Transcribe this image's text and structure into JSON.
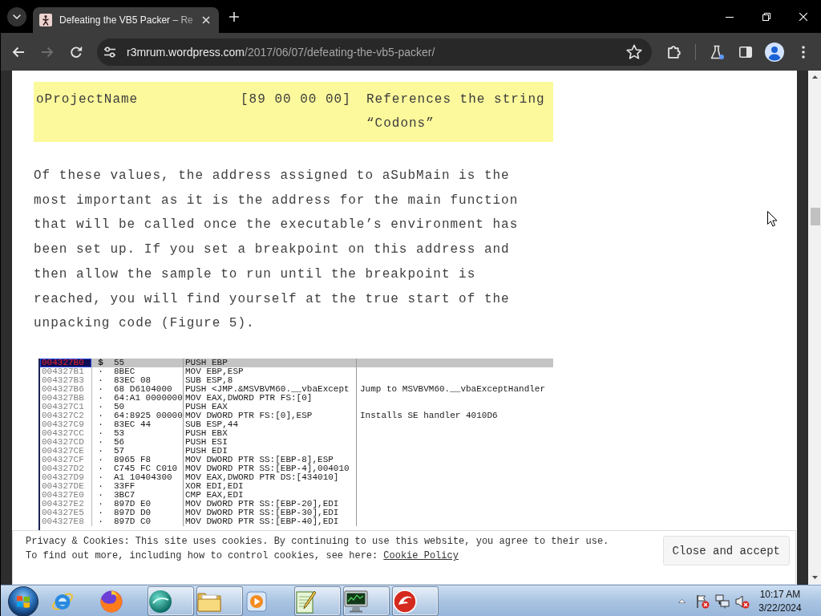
{
  "browser": {
    "tabs": [
      {
        "title": "Defeating the VB5 Packer – Re",
        "selected": true
      }
    ],
    "back_button": {
      "disabled": false
    },
    "forward_button": {
      "disabled": true
    },
    "address": {
      "host": "r3mrum.wordpress.com",
      "path": "/2017/06/07/defeating-the-vb5-packer/"
    }
  },
  "article": {
    "table": {
      "rows": [
        {
          "cells": [
            "oProjectName",
            "[89 00 00 00]",
            "References the string “Codons”"
          ]
        }
      ]
    },
    "paragraph": "Of these values, the address assigned to aSubMain is the most important as it is the address for the main function that will be called once the executable’s environment has been set up. If you set a breakpoint on this address and then allow the sample to run until the breakpoint is reached, you will find yourself at the true start of the unpacking code (Figure 5).",
    "figure": {
      "rows": [
        {
          "address": "004327B0",
          "marker": "$",
          "bytes": "55",
          "instruction": "PUSH EBP",
          "selected": true
        },
        {
          "address": "004327B1",
          "marker": "·",
          "bytes": "8BEC",
          "instruction": "MOV EBP,ESP",
          "selected": false
        },
        {
          "address": "004327B3",
          "marker": "·",
          "bytes": "83EC 08",
          "instruction": "SUB ESP,8",
          "selected": false
        },
        {
          "address": "004327B6",
          "marker": "·",
          "bytes": "68 D6104000",
          "instruction": "PUSH <JMP.&MSVBVM60.__vbaExcept",
          "comment": "Jump to MSVBVM60.__vbaExceptHandler",
          "selected": false
        },
        {
          "address": "004327BB",
          "marker": "·",
          "bytes": "64:A1 0000000",
          "instruction": "MOV EAX,DWORD PTR FS:[0]",
          "selected": false
        },
        {
          "address": "004327C1",
          "marker": "·",
          "bytes": "50",
          "instruction": "PUSH EAX",
          "selected": false
        },
        {
          "address": "004327C2",
          "marker": "·",
          "bytes": "64:8925 00000",
          "instruction": "MOV DWORD PTR FS:[0],ESP",
          "comment": "Installs SE handler 4010D6",
          "selected": false
        },
        {
          "address": "004327C9",
          "marker": "·",
          "bytes": "83EC 44",
          "instruction": "SUB ESP,44",
          "selected": false
        },
        {
          "address": "004327CC",
          "marker": "·",
          "bytes": "53",
          "instruction": "PUSH EBX",
          "selected": false
        },
        {
          "address": "004327CD",
          "marker": "·",
          "bytes": "56",
          "instruction": "PUSH ESI",
          "selected": false
        },
        {
          "address": "004327CE",
          "marker": "·",
          "bytes": "57",
          "instruction": "PUSH EDI",
          "selected": false
        },
        {
          "address": "004327CF",
          "marker": "·",
          "bytes": "8965 F8",
          "instruction": "MOV DWORD PTR SS:[EBP-8],ESP",
          "selected": false
        },
        {
          "address": "004327D2",
          "marker": "·",
          "bytes": "C745 FC C010",
          "instruction": "MOV DWORD PTR SS:[EBP-4],004010",
          "selected": false
        },
        {
          "address": "004327D9",
          "marker": "·",
          "bytes": "A1 10404300",
          "instruction": "MOV EAX,DWORD PTR DS:[434010]",
          "selected": false
        },
        {
          "address": "004327DE",
          "marker": "·",
          "bytes": "33FF",
          "instruction": "XOR EDI,EDI",
          "selected": false
        },
        {
          "address": "004327E0",
          "marker": "·",
          "bytes": "3BC7",
          "instruction": "CMP EAX,EDI",
          "selected": false
        },
        {
          "address": "004327E2",
          "marker": "·",
          "bytes": "897D E0",
          "instruction": "MOV DWORD PTR SS:[EBP-20],EDI",
          "selected": false
        },
        {
          "address": "004327E5",
          "marker": "·",
          "bytes": "897D D0",
          "instruction": "MOV DWORD PTR SS:[EBP-30],EDI",
          "selected": false
        },
        {
          "address": "004327E8",
          "marker": "·",
          "bytes": "897D C0",
          "instruction": "MOV DWORD PTR SS:[EBP-40],EDI",
          "selected": false
        }
      ]
    }
  },
  "cookie_banner": {
    "lines": [
      "Privacy & Cookies: This site uses cookies. By continuing to use this website, you agree to their use.",
      "To find out more, including how to control cookies, see here:"
    ],
    "link": "Cookie Policy",
    "button": "Close and accept"
  },
  "taskbar": {
    "apps": [
      {
        "running": false
      },
      {
        "running": false
      },
      {
        "running": true
      },
      {
        "running": true
      },
      {
        "running": false
      },
      {
        "running": true
      },
      {
        "running": true
      },
      {
        "running": true
      }
    ],
    "tray": {
      "flag_alert": true,
      "speaker_muted": true
    },
    "clock": {
      "time": "10:17 AM",
      "date": "3/22/2024"
    }
  }
}
